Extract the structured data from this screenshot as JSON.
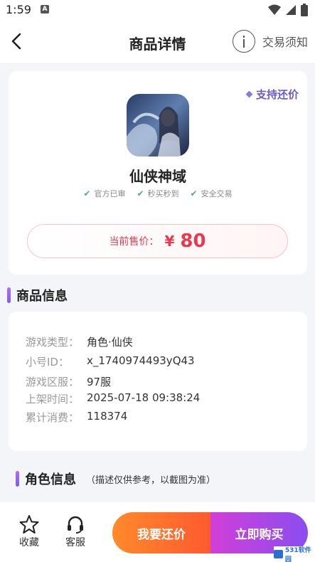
{
  "status_bar": {
    "time": "1:59",
    "a_label": "A"
  },
  "nav": {
    "title": "商品详情",
    "notice_label": "交易须知"
  },
  "product": {
    "bargain_label": "支持还价",
    "game_name": "仙侠神域",
    "badges": [
      "官方已审",
      "秒买秒到",
      "安全交易"
    ],
    "price_label": "当前售价：",
    "price_symbol": "¥",
    "price_value": "80"
  },
  "info_section": {
    "title": "商品信息",
    "rows": [
      {
        "key": "游戏类型：",
        "value": "角色·仙侠"
      },
      {
        "key": "小号ID：",
        "value": "x_1740974493yQ43"
      },
      {
        "key": "游戏区服：",
        "value": "97服"
      },
      {
        "key": "上架时间：",
        "value": "2025-07-18 09:38:24"
      },
      {
        "key": "累计消费：",
        "value": "118374"
      }
    ]
  },
  "role_section": {
    "title": "角色信息",
    "note": "（描述仅供参考，以截图为准）"
  },
  "bottom": {
    "favorite_label": "收藏",
    "service_label": "客服",
    "bargain_button": "我要还价",
    "buy_button": "立即购买"
  },
  "watermark": {
    "text": "531软件园"
  },
  "colors": {
    "price": "#e8394f",
    "accent": "#7b5cf0",
    "bargain_btn": "#ff6a2c",
    "buy_btn": "#b444e2"
  }
}
